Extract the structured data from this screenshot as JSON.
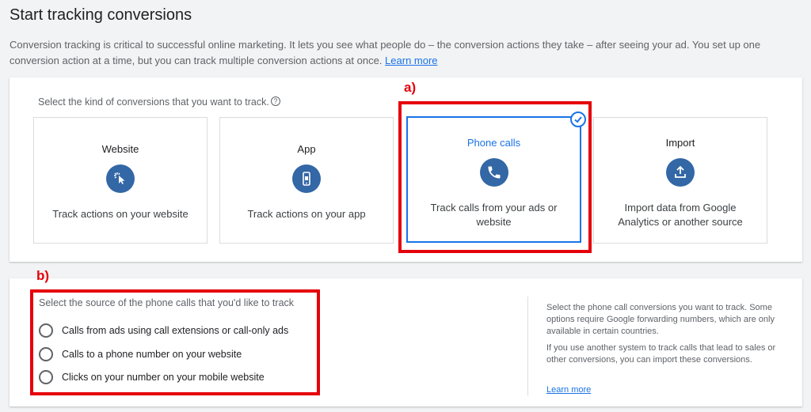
{
  "page": {
    "title": "Start tracking conversions",
    "intro": "Conversion tracking is critical to successful online marketing. It lets you see what people do – the conversion actions they take – after seeing your ad. You set up one conversion action at a time, but you can track multiple conversion actions at once.",
    "learn_more": "Learn more"
  },
  "kind_section": {
    "prompt": "Select the kind of conversions that you want to track.",
    "help_icon": "?",
    "tiles": [
      {
        "title": "Website",
        "description": "Track actions on your website",
        "icon": "cursor-click-icon"
      },
      {
        "title": "App",
        "description": "Track actions on your app",
        "icon": "mobile-phone-icon"
      },
      {
        "title": "Phone calls",
        "description": "Track calls from your ads or website",
        "icon": "phone-icon",
        "selected": true
      },
      {
        "title": "Import",
        "description": "Import data from Google Analytics or another source",
        "icon": "upload-icon"
      }
    ]
  },
  "source_section": {
    "prompt": "Select the source of the phone calls that you'd like to track",
    "options": [
      "Calls from ads using call extensions or call-only ads",
      "Calls to a phone number on your website",
      "Clicks on your number on your mobile website"
    ],
    "side_text_1": "Select the phone call conversions you want to track. Some options require Google forwarding numbers, which are only available in certain countries.",
    "side_text_2": "If you use another system to track calls that lead to sales or other conversions, you can import these conversions.",
    "side_link": "Learn more"
  },
  "annotations": {
    "a": "a)",
    "b": "b)",
    "highlight_color": "#e5000a"
  },
  "colors": {
    "accent": "#1a73e8",
    "icon_circle": "#3367a6",
    "background": "#f1f3f4"
  }
}
